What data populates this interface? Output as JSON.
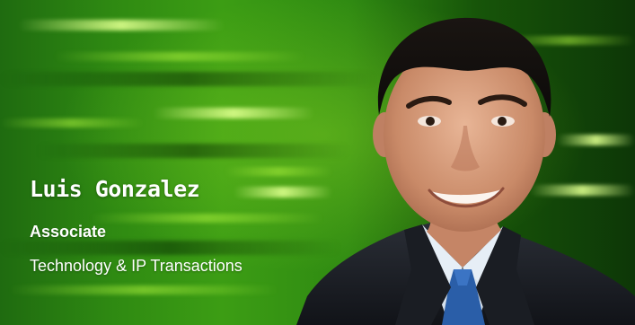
{
  "profile": {
    "name": "Luis Gonzalez",
    "position": "Associate",
    "practice": "Technology & IP Transactions"
  },
  "colors": {
    "background_green": "#2f8a12",
    "highlight_green": "#aef03c",
    "text": "#ffffff",
    "suit": "#1c1f26",
    "shirt": "#d6e1ec",
    "tie": "#2a5ea8"
  },
  "icons": {
    "portrait": "person-photo"
  }
}
